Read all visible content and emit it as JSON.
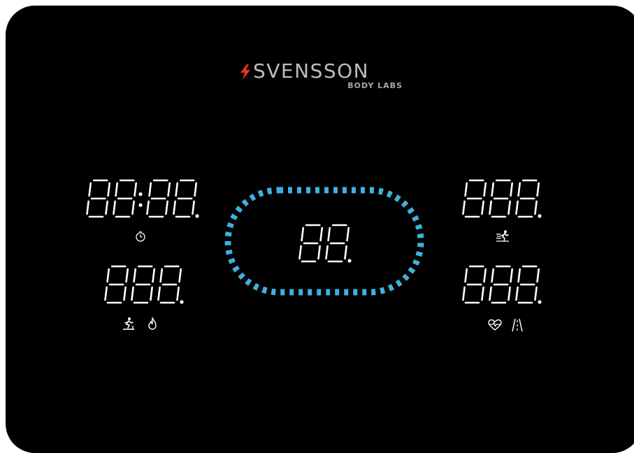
{
  "brand": {
    "name": "SVENSSON",
    "sub": "BODY LABS",
    "accent_color": "#e2312b",
    "text_color": "#bdbdbd"
  },
  "display": {
    "background": "#000000",
    "segment_color": "#ffffff",
    "track_color": "#3fb0df",
    "time": {
      "digits": "88:88.",
      "icon": "stopwatch-icon"
    },
    "speed": {
      "digits": "888.",
      "icons": [
        "treadmill-runner-icon",
        "flame-icon"
      ]
    },
    "center": {
      "digits": "88."
    },
    "top_right": {
      "digits": "888.",
      "icon": "running-speed-icon"
    },
    "bottom_right": {
      "digits": "888.",
      "icons": [
        "heart-rate-icon",
        "road-distance-icon"
      ]
    }
  }
}
